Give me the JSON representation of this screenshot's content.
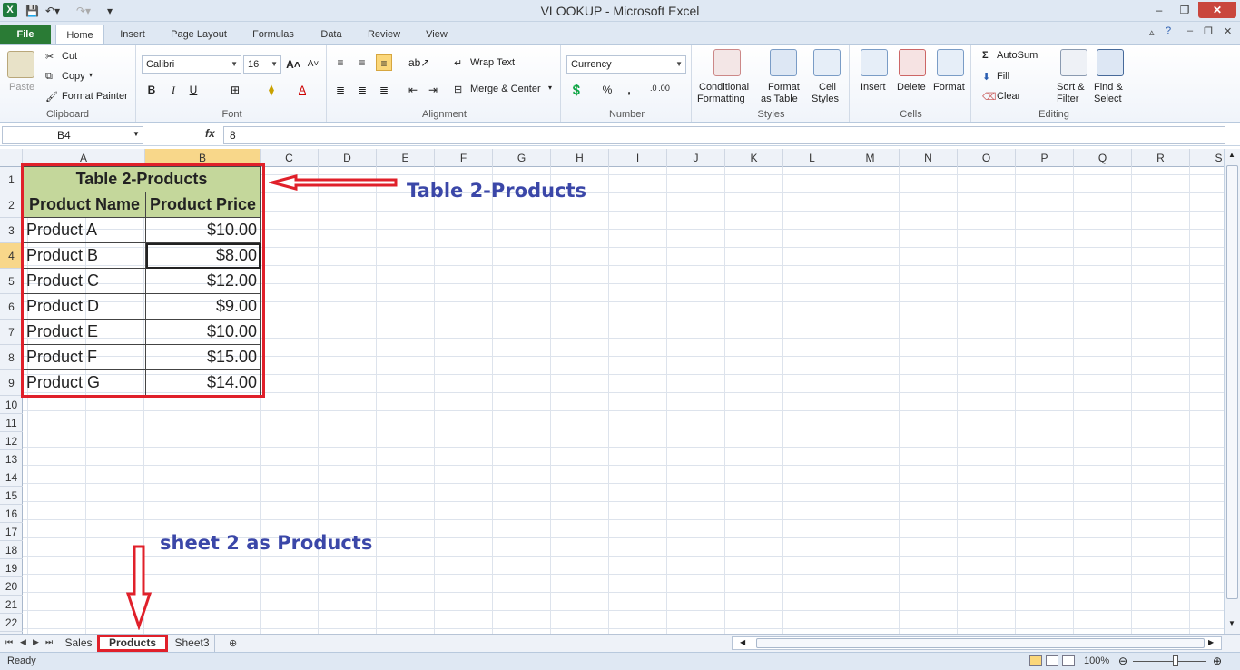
{
  "window": {
    "title": "VLOOKUP  -  Microsoft Excel",
    "app_icon": "X",
    "controls": {
      "minimize": "–",
      "restore": "❐",
      "close": "✕"
    }
  },
  "ribbon_tabs": [
    "File",
    "Home",
    "Insert",
    "Page Layout",
    "Formulas",
    "Data",
    "Review",
    "View"
  ],
  "clipboard": {
    "paste": "Paste",
    "cut": "Cut",
    "copy": "Copy",
    "format_painter": "Format Painter",
    "group": "Clipboard"
  },
  "font": {
    "name": "Calibri",
    "size": "16",
    "bold": "B",
    "italic": "I",
    "underline": "U",
    "group": "Font"
  },
  "alignment": {
    "wrap_text": "Wrap Text",
    "merge_center": "Merge & Center",
    "group": "Alignment"
  },
  "number": {
    "format": "Currency",
    "percent": "%",
    "comma": ",",
    "inc_decimal": ".0 .00",
    "group": "Number"
  },
  "styles": {
    "conditional_1": "Conditional",
    "conditional_2": "Formatting",
    "format_table_1": "Format",
    "format_table_2": "as Table",
    "cell_styles_1": "Cell",
    "cell_styles_2": "Styles",
    "group": "Styles"
  },
  "cells_group": {
    "insert": "Insert",
    "delete": "Delete",
    "format": "Format",
    "group": "Cells"
  },
  "editing": {
    "autosum": "AutoSum",
    "fill": "Fill",
    "clear": "Clear",
    "sort_1": "Sort &",
    "sort_2": "Filter",
    "find_1": "Find &",
    "find_2": "Select",
    "group": "Editing"
  },
  "formula_bar": {
    "name_box": "B4",
    "fx": "fx",
    "value": "8"
  },
  "columns": [
    "A",
    "B",
    "C",
    "D",
    "E",
    "F",
    "G",
    "H",
    "I",
    "J",
    "K",
    "L",
    "M",
    "N",
    "O",
    "P",
    "Q",
    "R",
    "S"
  ],
  "rows": [
    "1",
    "2",
    "3",
    "4",
    "5",
    "6",
    "7",
    "8",
    "9",
    "10",
    "11",
    "12",
    "13",
    "14",
    "15",
    "16",
    "17",
    "18",
    "19",
    "20",
    "21",
    "22"
  ],
  "table": {
    "title": "Table 2-Products",
    "headers": [
      "Product Name",
      "Product Price"
    ],
    "rows": [
      [
        "Product A",
        "$10.00"
      ],
      [
        "Product B",
        "$8.00"
      ],
      [
        "Product C",
        "$12.00"
      ],
      [
        "Product D",
        "$9.00"
      ],
      [
        "Product E",
        "$10.00"
      ],
      [
        "Product F",
        "$15.00"
      ],
      [
        "Product G",
        "$14.00"
      ]
    ]
  },
  "annotations": {
    "table_label": "Table 2-Products",
    "sheet_label": "sheet 2 as Products"
  },
  "sheet_tabs": [
    "Sales",
    "Products",
    "Sheet3"
  ],
  "status": {
    "text": "Ready",
    "zoom": "100%"
  },
  "colors": {
    "annotation": "#3b47a8",
    "highlight_box": "#e0202a",
    "table_header": "#c4d79b",
    "file_tab": "#2a7b35"
  }
}
